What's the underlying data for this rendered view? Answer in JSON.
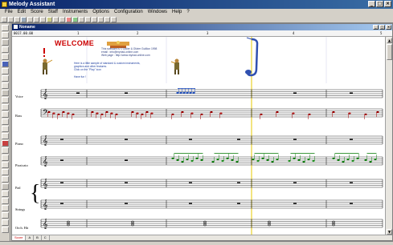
{
  "window": {
    "title": "Melody Assistant",
    "controls": [
      "_",
      "□",
      "×"
    ]
  },
  "menu": [
    "File",
    "Edit",
    "Score",
    "Staff",
    "Instruments",
    "Options",
    "Configuration",
    "Windows",
    "Help",
    "?"
  ],
  "document": {
    "title": "Noname",
    "timecode": "0017.00.00",
    "bars": [
      "1",
      "2",
      "3",
      "4",
      "5"
    ]
  },
  "welcome": {
    "heading": "WELCOME",
    "info_lines": "This software is © Didier & Olivier Guillion 1998\nemail : info@myriad-online.com\nWeb page : http://www.myriad-online.com",
    "sample_lines": "Here is a little sample of standard & custom instruments,\ngraphics and other features.\nClick on the \"Play\" icon\n\nHave fun !"
  },
  "staves": [
    {
      "name": "Voice",
      "color": "#2050c0"
    },
    {
      "name": "Bass",
      "color": "#a00000"
    },
    {
      "name": "Piano",
      "color": "#000000"
    },
    {
      "name": "Pizzicato",
      "color": "#108010"
    },
    {
      "name": "Pad",
      "color": "#000000"
    },
    {
      "name": "Strings",
      "color": "#000000"
    },
    {
      "name": "Orch. Hit",
      "color": "#000000"
    }
  ],
  "sheet_tabs": [
    "Score",
    "A",
    "B",
    "C"
  ],
  "colors": {
    "titlebar_start": "#0a246a",
    "titlebar_end": "#3a6ea5",
    "playhead": "#e6c800",
    "accent_red": "#cc0000"
  }
}
